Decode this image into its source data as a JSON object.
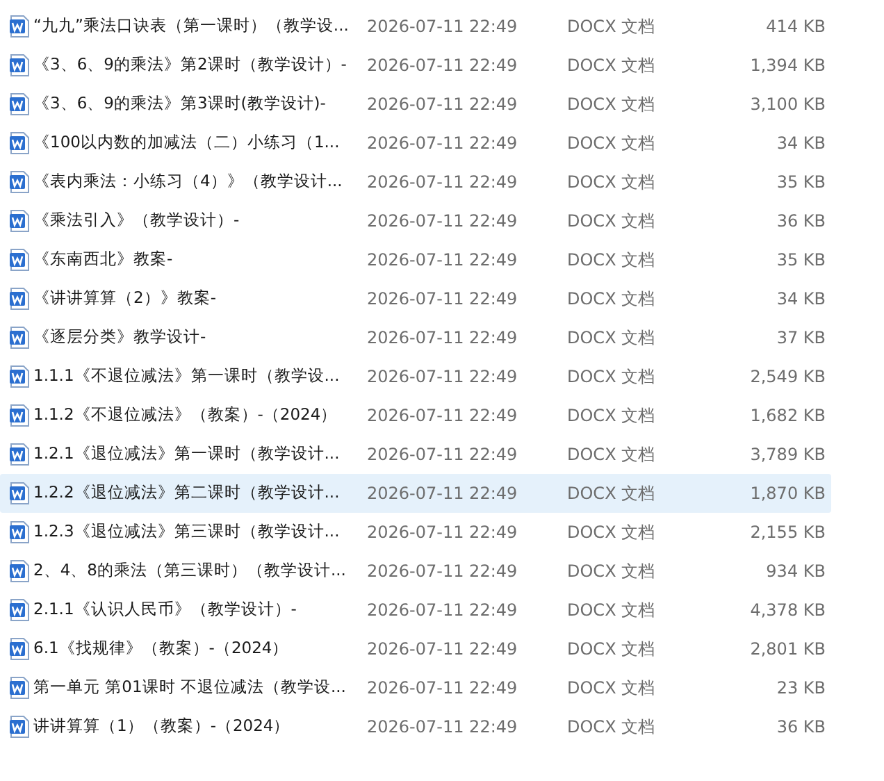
{
  "files": [
    {
      "name": "“九九”乘法口诀表（第一课时）（教学设...",
      "modified": "2026-07-11 22:49",
      "type": "DOCX 文档",
      "size": "414 KB",
      "selected": false
    },
    {
      "name": "《3、6、9的乘法》第2课时（教学设计）-",
      "modified": "2026-07-11 22:49",
      "type": "DOCX 文档",
      "size": "1,394 KB",
      "selected": false
    },
    {
      "name": "《3、6、9的乘法》第3课时(教学设计)-",
      "modified": "2026-07-11 22:49",
      "type": "DOCX 文档",
      "size": "3,100 KB",
      "selected": false
    },
    {
      "name": "《100以内数的加减法（二）小练习（1...",
      "modified": "2026-07-11 22:49",
      "type": "DOCX 文档",
      "size": "34 KB",
      "selected": false
    },
    {
      "name": "《表内乘法：小练习（4）》（教学设计...",
      "modified": "2026-07-11 22:49",
      "type": "DOCX 文档",
      "size": "35 KB",
      "selected": false
    },
    {
      "name": "《乘法引入》（教学设计）-",
      "modified": "2026-07-11 22:49",
      "type": "DOCX 文档",
      "size": "36 KB",
      "selected": false
    },
    {
      "name": "《东南西北》教案-",
      "modified": "2026-07-11 22:49",
      "type": "DOCX 文档",
      "size": "35 KB",
      "selected": false
    },
    {
      "name": "《讲讲算算（2）》教案-",
      "modified": "2026-07-11 22:49",
      "type": "DOCX 文档",
      "size": "34 KB",
      "selected": false
    },
    {
      "name": "《逐层分类》教学设计-",
      "modified": "2026-07-11 22:49",
      "type": "DOCX 文档",
      "size": "37 KB",
      "selected": false
    },
    {
      "name": "1.1.1《不退位减法》第一课时（教学设...",
      "modified": "2026-07-11 22:49",
      "type": "DOCX 文档",
      "size": "2,549 KB",
      "selected": false
    },
    {
      "name": "1.1.2《不退位减法》（教案）-（2024）",
      "modified": "2026-07-11 22:49",
      "type": "DOCX 文档",
      "size": "1,682 KB",
      "selected": false
    },
    {
      "name": "1.2.1《退位减法》第一课时（教学设计...",
      "modified": "2026-07-11 22:49",
      "type": "DOCX 文档",
      "size": "3,789 KB",
      "selected": false
    },
    {
      "name": "1.2.2《退位减法》第二课时（教学设计...",
      "modified": "2026-07-11 22:49",
      "type": "DOCX 文档",
      "size": "1,870 KB",
      "selected": true
    },
    {
      "name": "1.2.3《退位减法》第三课时（教学设计...",
      "modified": "2026-07-11 22:49",
      "type": "DOCX 文档",
      "size": "2,155 KB",
      "selected": false
    },
    {
      "name": "2、4、8的乘法（第三课时）（教学设计...",
      "modified": "2026-07-11 22:49",
      "type": "DOCX 文档",
      "size": "934 KB",
      "selected": false
    },
    {
      "name": "2.1.1《认识人民币》（教学设计）-",
      "modified": "2026-07-11 22:49",
      "type": "DOCX 文档",
      "size": "4,378 KB",
      "selected": false
    },
    {
      "name": "6.1《找规律》（教案）-（2024）",
      "modified": "2026-07-11 22:49",
      "type": "DOCX 文档",
      "size": "2,801 KB",
      "selected": false
    },
    {
      "name": "第一单元 第01课时 不退位减法（教学设...",
      "modified": "2026-07-11 22:49",
      "type": "DOCX 文档",
      "size": "23 KB",
      "selected": false
    },
    {
      "name": "讲讲算算（1）（教案）-（2024）",
      "modified": "2026-07-11 22:49",
      "type": "DOCX 文档",
      "size": "36 KB",
      "selected": false
    }
  ]
}
